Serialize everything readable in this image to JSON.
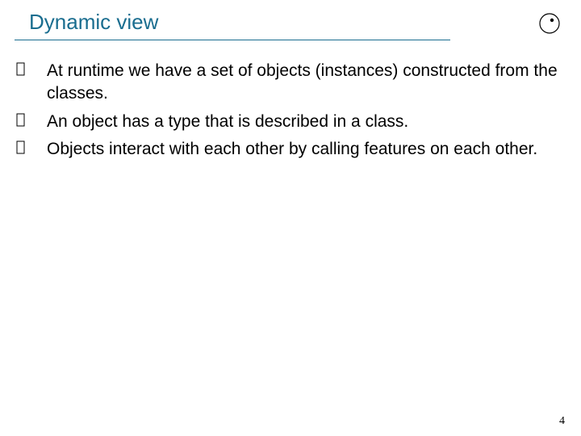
{
  "slide": {
    "title": "Dynamic view",
    "bullets": [
      "At runtime we have a set of objects (instances) constructed from the classes.",
      "An object has a type that is described in a class.",
      "Objects interact with each other by calling features on each other."
    ]
  },
  "footer": {
    "page_number": "4"
  },
  "icons": {
    "logo": "eiffel-logo"
  }
}
